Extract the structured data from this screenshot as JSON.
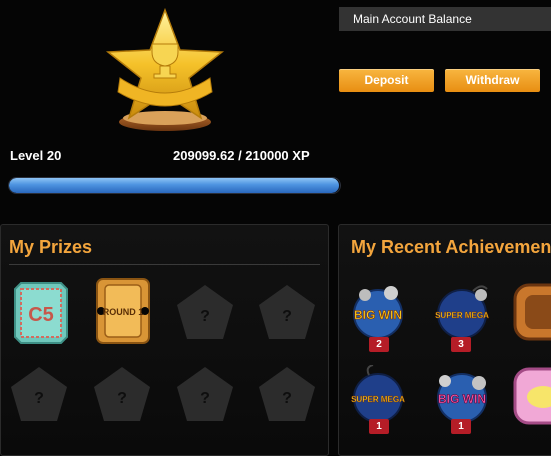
{
  "player": {
    "level_label": "Level 20",
    "xp_text": "209099.62 / 210000 XP",
    "xp_progress": 0.9957
  },
  "account": {
    "balance_label": "Main Account Balance",
    "deposit_label": "Deposit",
    "withdraw_label": "Withdraw"
  },
  "prizes": {
    "title": "My Prizes",
    "items": [
      {
        "icon": "c5-ticket-icon",
        "text": "C5"
      },
      {
        "icon": "round-1-ticket-icon",
        "text": "ROUND 1"
      },
      {
        "icon": "locked-prize-icon",
        "text": "?"
      },
      {
        "icon": "locked-prize-icon",
        "text": "?"
      },
      {
        "icon": "locked-prize-icon",
        "text": "?"
      },
      {
        "icon": "locked-prize-icon",
        "text": "?"
      },
      {
        "icon": "locked-prize-icon",
        "text": "?"
      },
      {
        "icon": "locked-prize-icon",
        "text": "?"
      }
    ]
  },
  "achievements": {
    "title": "My Recent Achievements",
    "items": [
      {
        "icon": "big-win-bomb-icon",
        "text": "BIG WIN",
        "count": "2"
      },
      {
        "icon": "super-mega-bomb-icon",
        "text": "SUPER MEGA",
        "count": "3"
      },
      {
        "icon": "wooden-frame-icon"
      },
      {
        "icon": "super-mega-bomb-icon",
        "text": "SUPER MEGA",
        "count": "1"
      },
      {
        "icon": "big-win-bomb-icon",
        "text": "BIG WIN",
        "count": "1"
      },
      {
        "icon": "fish-icon"
      }
    ]
  },
  "colors": {
    "accent_orange": "#f3a53d",
    "button_orange": "#f0a028",
    "badge_red": "#b51d27",
    "xp_blue": "#4d93e0"
  }
}
